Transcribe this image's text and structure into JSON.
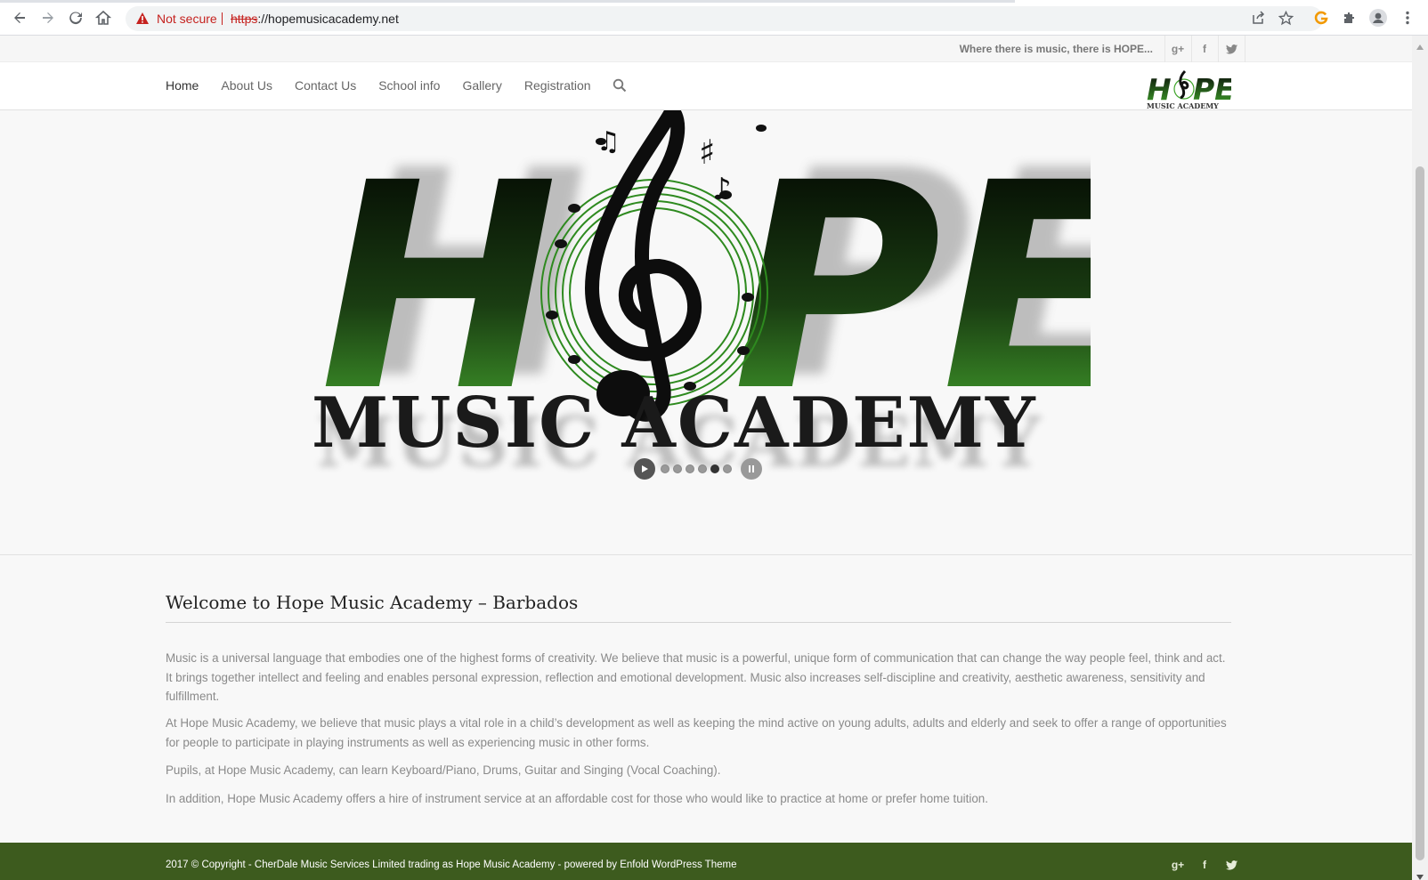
{
  "browser": {
    "not_secure_label": "Not secure",
    "url_protocol": "https",
    "url_rest": "://hopemusicacademy.net",
    "icons": [
      "back-icon",
      "forward-icon",
      "reload-icon",
      "home-icon",
      "warning-icon",
      "share-icon",
      "star-icon",
      "extension-g-icon",
      "puzzle-icon",
      "profile-icon",
      "kebab-menu-icon"
    ]
  },
  "topbar": {
    "tagline": "Where there is music, there is HOPE...",
    "social": [
      {
        "name": "google-plus-icon",
        "glyph": "g+"
      },
      {
        "name": "facebook-icon",
        "glyph": "f"
      },
      {
        "name": "twitter-icon",
        "glyph": "t"
      }
    ]
  },
  "nav": {
    "items": [
      {
        "label": "Home",
        "active": true
      },
      {
        "label": "About Us",
        "active": false
      },
      {
        "label": "Contact Us",
        "active": false
      },
      {
        "label": "School info",
        "active": false
      },
      {
        "label": "Gallery",
        "active": false
      },
      {
        "label": "Registration",
        "active": false
      }
    ]
  },
  "logo": {
    "word": "HOPE",
    "sub": "Music Academy"
  },
  "slider": {
    "dots": 6,
    "active_dot": 5
  },
  "content": {
    "title": "Welcome to Hope Music Academy – Barbados",
    "paragraphs": [
      "Music is a universal language that embodies one of the highest forms of creativity. We believe that music is a powerful, unique form of communication that can change the way people feel, think and act. It brings together intellect and feeling and enables personal expression, reflection and emotional development. Music also increases self-discipline and creativity, aesthetic awareness, sensitivity and fulfillment.",
      "At Hope Music Academy, we believe that music plays a vital role in a child’s development as well as keeping the mind active on young adults, adults and elderly and seek to offer a range of opportunities for people to participate in playing instruments as well as experiencing music in other forms.",
      "Pupils, at Hope Music Academy, can learn Keyboard/Piano, Drums, Guitar and Singing (Vocal Coaching).",
      "In addition, Hope Music Academy offers a hire of instrument service at an affordable cost for those who would like to practice at home or prefer home tuition."
    ]
  },
  "footer": {
    "copyright": "2017 © Copyright - CherDale Music Services Limited trading as Hope Music Academy - powered by Enfold WordPress Theme"
  },
  "colors": {
    "footer_bg": "#3d5b1e",
    "logo_green": "#3fa52a",
    "not_secure": "#c5221f"
  }
}
